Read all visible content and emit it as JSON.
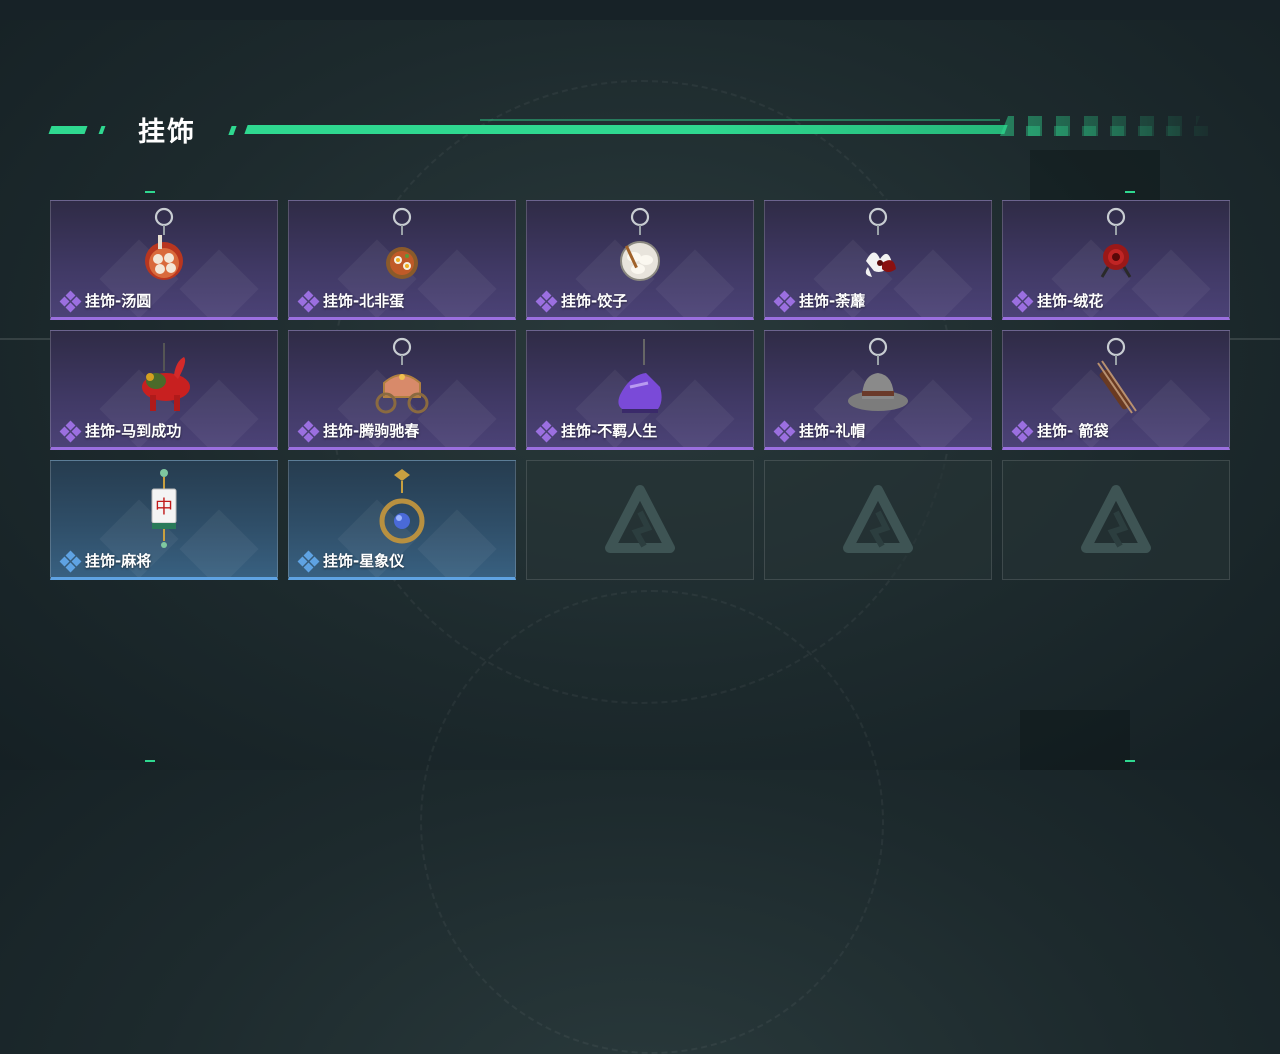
{
  "page": {
    "title": "挂饰"
  },
  "colors": {
    "accent": "#2fd890",
    "epic": "#9b6fe0",
    "rare": "#5fa3e3"
  },
  "items": [
    {
      "label": "挂饰-汤圆",
      "rarity": "epic",
      "icon": "tangyuan-pendant-icon"
    },
    {
      "label": "挂饰-北非蛋",
      "rarity": "epic",
      "icon": "shakshuka-pendant-icon"
    },
    {
      "label": "挂饰-饺子",
      "rarity": "epic",
      "icon": "dumpling-pendant-icon"
    },
    {
      "label": "挂饰-荼蘼",
      "rarity": "epic",
      "icon": "flower-pendant-icon"
    },
    {
      "label": "挂饰-绒花",
      "rarity": "epic",
      "icon": "velvet-flower-pendant-icon"
    },
    {
      "label": "挂饰-马到成功",
      "rarity": "epic",
      "icon": "red-horse-pendant-icon"
    },
    {
      "label": "挂饰-腾驹驰春",
      "rarity": "epic",
      "icon": "carriage-pendant-icon"
    },
    {
      "label": "挂饰-不羁人生",
      "rarity": "epic",
      "icon": "sneaker-pendant-icon"
    },
    {
      "label": "挂饰-礼帽",
      "rarity": "epic",
      "icon": "fedora-pendant-icon"
    },
    {
      "label": "挂饰- 箭袋",
      "rarity": "epic",
      "icon": "quiver-pendant-icon"
    },
    {
      "label": "挂饰-麻将",
      "rarity": "rare",
      "icon": "mahjong-pendant-icon",
      "glyph": "中"
    },
    {
      "label": "挂饰-星象仪",
      "rarity": "rare",
      "icon": "astrolabe-pendant-icon"
    }
  ],
  "empty_slots": [
    {
      "icon": "game-logo-icon"
    },
    {
      "icon": "game-logo-icon"
    },
    {
      "icon": "game-logo-icon"
    }
  ]
}
